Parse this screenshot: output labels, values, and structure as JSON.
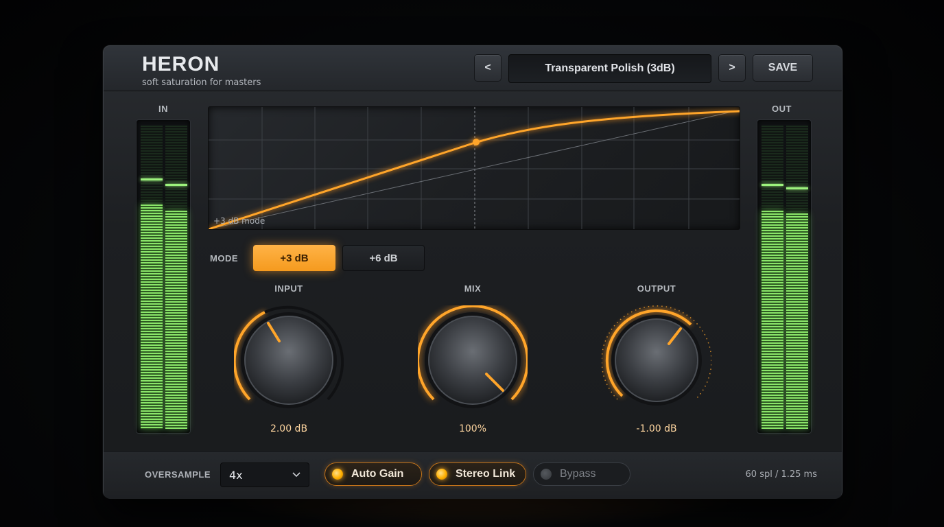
{
  "app": {
    "title": "HERON",
    "subtitle": "soft saturation for masters"
  },
  "preset": {
    "prev_label": "<",
    "name": "Transparent Polish (3dB)",
    "next_label": ">",
    "save_label": "SAVE"
  },
  "meters": {
    "in_label": "IN",
    "out_label": "OUT",
    "in_levels": [
      0.74,
      0.72
    ],
    "out_levels": [
      0.72,
      0.71
    ]
  },
  "graph": {
    "caption": "+3 dB mode"
  },
  "mode": {
    "label": "MODE",
    "options": [
      "+3 dB",
      "+6 dB"
    ],
    "selected": "+3 dB"
  },
  "knobs": {
    "input": {
      "label": "INPUT",
      "value": "2.00 dB"
    },
    "mix": {
      "label": "MIX",
      "value": "100%"
    },
    "output": {
      "label": "OUTPUT",
      "value": "-1.00 dB"
    }
  },
  "footer": {
    "oversample_label": "OVERSAMPLE",
    "oversample_value": "4x",
    "auto_gain_label": "Auto Gain",
    "auto_gain_on": true,
    "stereo_link_label": "Stereo Link",
    "stereo_link_on": true,
    "bypass_label": "Bypass",
    "bypass_on": false,
    "latency": "60 spl / 1.25 ms"
  },
  "colors": {
    "accent": "#ffa52a",
    "meter_green": "#8be66a"
  },
  "icons": {
    "dropdown": "chevron-down-icon"
  }
}
